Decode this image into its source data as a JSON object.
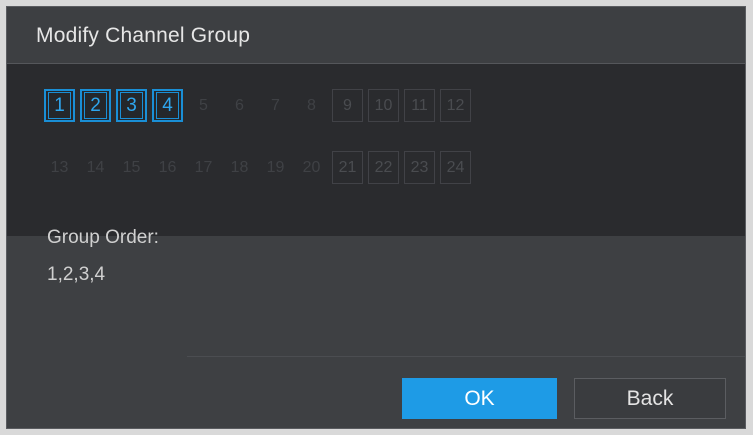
{
  "dialog": {
    "title": "Modify Channel Group",
    "group_order_label": "Group Order:",
    "group_order_value": "1,2,3,4",
    "ok_label": "OK",
    "back_label": "Back"
  },
  "channels": {
    "row1": [
      {
        "num": "1",
        "selected": true,
        "style": "selected"
      },
      {
        "num": "2",
        "selected": true,
        "style": "selected"
      },
      {
        "num": "3",
        "selected": true,
        "style": "selected"
      },
      {
        "num": "4",
        "selected": true,
        "style": "selected"
      },
      {
        "num": "5",
        "selected": false,
        "style": "faint"
      },
      {
        "num": "6",
        "selected": false,
        "style": "faint"
      },
      {
        "num": "7",
        "selected": false,
        "style": "faint"
      },
      {
        "num": "8",
        "selected": false,
        "style": "faint"
      },
      {
        "num": "9",
        "selected": false,
        "style": "boxed"
      },
      {
        "num": "10",
        "selected": false,
        "style": "boxed"
      },
      {
        "num": "11",
        "selected": false,
        "style": "boxed"
      },
      {
        "num": "12",
        "selected": false,
        "style": "boxed"
      }
    ],
    "row2": [
      {
        "num": "13",
        "selected": false,
        "style": "faint"
      },
      {
        "num": "14",
        "selected": false,
        "style": "faint"
      },
      {
        "num": "15",
        "selected": false,
        "style": "faint"
      },
      {
        "num": "16",
        "selected": false,
        "style": "faint"
      },
      {
        "num": "17",
        "selected": false,
        "style": "faint"
      },
      {
        "num": "18",
        "selected": false,
        "style": "faint"
      },
      {
        "num": "19",
        "selected": false,
        "style": "faint"
      },
      {
        "num": "20",
        "selected": false,
        "style": "faint"
      },
      {
        "num": "21",
        "selected": false,
        "style": "boxed"
      },
      {
        "num": "22",
        "selected": false,
        "style": "boxed"
      },
      {
        "num": "23",
        "selected": false,
        "style": "boxed"
      },
      {
        "num": "24",
        "selected": false,
        "style": "boxed"
      }
    ]
  },
  "colors": {
    "accent": "#1e9be6",
    "dialog_bg": "#3e4043",
    "panel_bg": "#2a2b2e"
  }
}
